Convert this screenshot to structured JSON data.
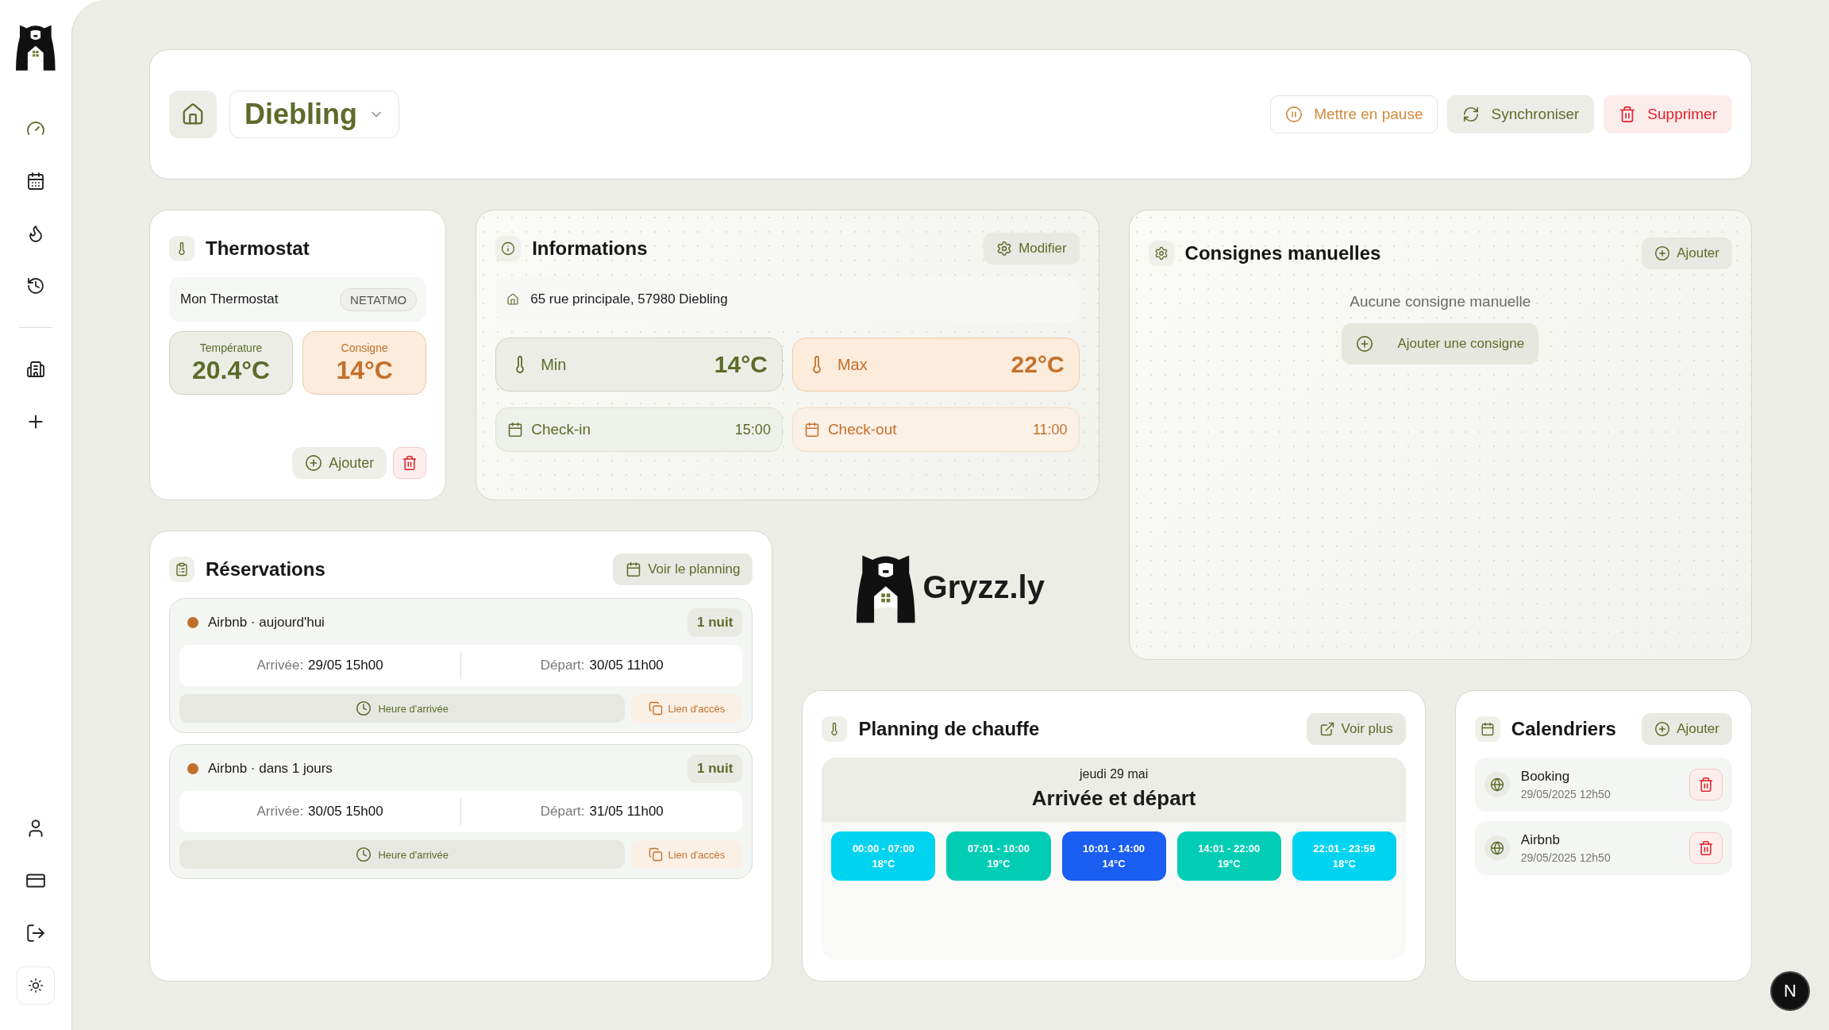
{
  "sidebar": {
    "nav": [
      {
        "selected": true
      },
      {
        "selected": false
      },
      {
        "selected": false
      },
      {
        "selected": false
      }
    ]
  },
  "header": {
    "property": "Diebling",
    "actions": [
      {
        "kind": "pause",
        "label": "Mettre en pause"
      },
      {
        "kind": "sync",
        "label": "Synchroniser"
      },
      {
        "kind": "delete",
        "label": "Supprimer"
      }
    ]
  },
  "thermostat": {
    "title": "Thermostat",
    "device": "Mon Thermostat",
    "brand": "NETATMO",
    "readings": [
      {
        "kind": "current",
        "label": "Température",
        "value": "20.4°C"
      },
      {
        "kind": "target",
        "label": "Consigne",
        "value": "14°C"
      }
    ],
    "add_label": "Ajouter"
  },
  "informations": {
    "title": "Informations",
    "edit_label": "Modifier",
    "address": "65 rue principale, 57980 Diebling",
    "limits": [
      {
        "kind": "min",
        "label": "Min",
        "value": "14°C"
      },
      {
        "kind": "max",
        "label": "Max",
        "value": "22°C"
      }
    ],
    "times": [
      {
        "kind": "checkin",
        "label": "Check-in",
        "value": "15:00"
      },
      {
        "kind": "checkout",
        "label": "Check-out",
        "value": "11:00"
      }
    ]
  },
  "manual_setpoints": {
    "title": "Consignes manuelles",
    "add_label": "Ajouter",
    "empty_text": "Aucune consigne manuelle",
    "add_setpoint_label": "Ajouter une consigne"
  },
  "reservations": {
    "title": "Réservations",
    "planning_label": "Voir le planning",
    "items": [
      {
        "color": "#c0702a",
        "source": "Airbnb · aujourd'hui",
        "nights": "1 nuit",
        "arrival_label": "Arrivée:",
        "arrival": "29/05 15h00",
        "departure_label": "Départ:",
        "departure": "30/05 11h00",
        "arrival_time_label": "Heure d'arrivée",
        "access_link_label": "Lien d'accès"
      },
      {
        "color": "#c0702a",
        "source": "Airbnb · dans 1 jours",
        "nights": "1 nuit",
        "arrival_label": "Arrivée:",
        "arrival": "30/05 15h00",
        "departure_label": "Départ:",
        "departure": "31/05 11h00",
        "arrival_time_label": "Heure d'arrivée",
        "access_link_label": "Lien d'accès"
      }
    ]
  },
  "brand": "Gryzz.ly",
  "heating_schedule": {
    "title": "Planning de chauffe",
    "more_label": "Voir plus",
    "date": "jeudi 29 mai",
    "mode": "Arrivée et départ",
    "slots": [
      {
        "time": "00:00 - 07:00",
        "temp": "18°C",
        "color": "#00d3f0"
      },
      {
        "time": "07:01 - 10:00",
        "temp": "19°C",
        "color": "#00cdb4"
      },
      {
        "time": "10:01 - 14:00",
        "temp": "14°C",
        "color": "#1a5ef2"
      },
      {
        "time": "14:01 - 22:00",
        "temp": "19°C",
        "color": "#00cdb4"
      },
      {
        "time": "22:01 - 23:59",
        "temp": "18°C",
        "color": "#00d3f0"
      }
    ]
  },
  "calendars": {
    "title": "Calendriers",
    "add_label": "Ajouter",
    "items": [
      {
        "name": "Booking",
        "synced": "29/05/2025 12h50"
      },
      {
        "name": "Airbnb",
        "synced": "29/05/2025 12h50"
      }
    ]
  },
  "dev_badge": "N"
}
